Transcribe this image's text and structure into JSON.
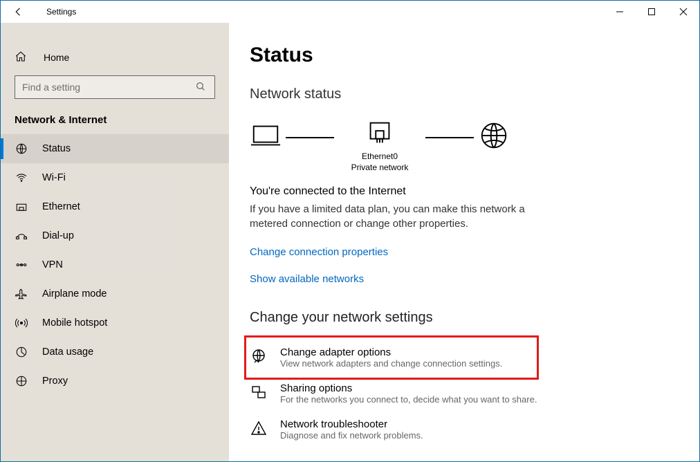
{
  "window": {
    "title": "Settings"
  },
  "sidebar": {
    "home": "Home",
    "search_placeholder": "Find a setting",
    "category": "Network & Internet",
    "items": [
      {
        "label": "Status",
        "icon": "globe-status"
      },
      {
        "label": "Wi-Fi",
        "icon": "wifi"
      },
      {
        "label": "Ethernet",
        "icon": "ethernet"
      },
      {
        "label": "Dial-up",
        "icon": "dialup"
      },
      {
        "label": "VPN",
        "icon": "vpn"
      },
      {
        "label": "Airplane mode",
        "icon": "airplane"
      },
      {
        "label": "Mobile hotspot",
        "icon": "hotspot"
      },
      {
        "label": "Data usage",
        "icon": "datausage"
      },
      {
        "label": "Proxy",
        "icon": "proxy"
      }
    ],
    "active_index": 0
  },
  "main": {
    "heading": "Status",
    "network_status_heading": "Network status",
    "diagram": {
      "adapter_name": "Ethernet0",
      "adapter_type": "Private network"
    },
    "connected_heading": "You're connected to the Internet",
    "connected_body": "If you have a limited data plan, you can make this network a metered connection or change other properties.",
    "link_change_props": "Change connection properties",
    "link_show_networks": "Show available networks",
    "change_heading": "Change your network settings",
    "options": [
      {
        "title": "Change adapter options",
        "desc": "View network adapters and change connection settings.",
        "highlight": true
      },
      {
        "title": "Sharing options",
        "desc": "For the networks you connect to, decide what you want to share."
      },
      {
        "title": "Network troubleshooter",
        "desc": "Diagnose and fix network problems."
      }
    ]
  }
}
